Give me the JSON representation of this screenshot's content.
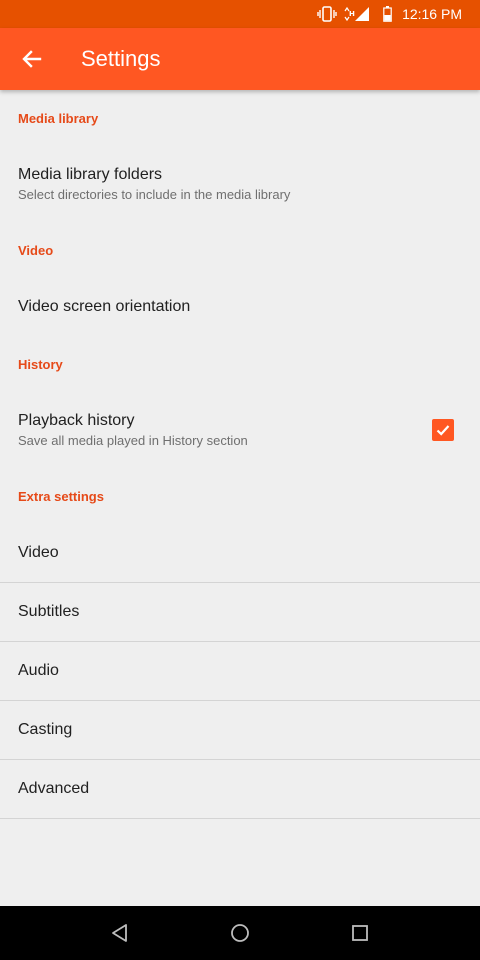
{
  "status_bar": {
    "time": "12:16 PM",
    "icons": [
      "vibrate-icon",
      "data-hplus-icon",
      "signal-icon",
      "battery-icon"
    ]
  },
  "app_bar": {
    "title": "Settings",
    "back_icon": "arrow-back-icon"
  },
  "colors": {
    "status_bar": "#e65100",
    "app_bar": "#ff5722",
    "accent": "#e64a19",
    "background": "#efefef"
  },
  "sections": {
    "media_library": {
      "header": "Media library",
      "folders": {
        "title": "Media library folders",
        "summary": "Select directories to include in the media library"
      }
    },
    "video": {
      "header": "Video",
      "orientation": {
        "title": "Video screen orientation"
      }
    },
    "history": {
      "header": "History",
      "playback": {
        "title": "Playback history",
        "summary": "Save all media played in History section",
        "checked": true
      }
    },
    "extra": {
      "header": "Extra settings",
      "items": [
        {
          "label": "Video"
        },
        {
          "label": "Subtitles"
        },
        {
          "label": "Audio"
        },
        {
          "label": "Casting"
        },
        {
          "label": "Advanced"
        }
      ]
    }
  },
  "nav_bar": {
    "icons": [
      "nav-back-icon",
      "nav-home-icon",
      "nav-recents-icon"
    ]
  }
}
